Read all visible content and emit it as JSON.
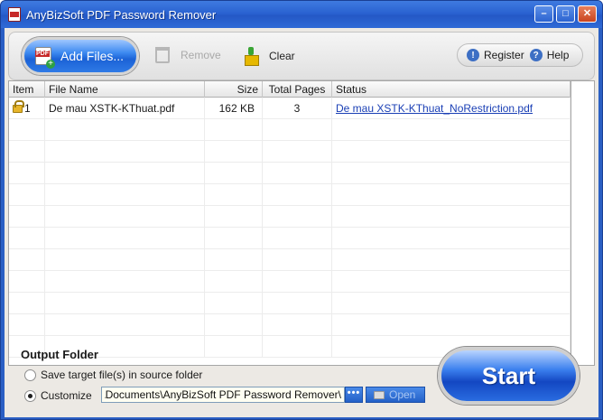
{
  "window": {
    "title": "AnyBizSoft PDF Password Remover"
  },
  "title_controls": {
    "minimize": "–",
    "restore": "□",
    "close": "✕"
  },
  "toolbar": {
    "add_files": "Add Files...",
    "remove": "Remove",
    "clear": "Clear",
    "register": "Register",
    "help": "Help"
  },
  "grid": {
    "columns": [
      "Item",
      "File Name",
      "Size",
      "Total Pages",
      "Status"
    ],
    "rows": [
      {
        "item": "1",
        "file_name": "De mau XSTK-KThuat.pdf",
        "size": "162  KB",
        "total_pages": "3",
        "status": "De mau XSTK-KThuat_NoRestriction.pdf"
      }
    ]
  },
  "output": {
    "title": "Output Folder",
    "option_source": "Save target file(s) in source folder",
    "option_customize": "Customize",
    "path": "\\Documents\\AnyBizSoft PDF Password Remover\\",
    "browse": "•••",
    "open": "Open"
  },
  "start": "Start"
}
